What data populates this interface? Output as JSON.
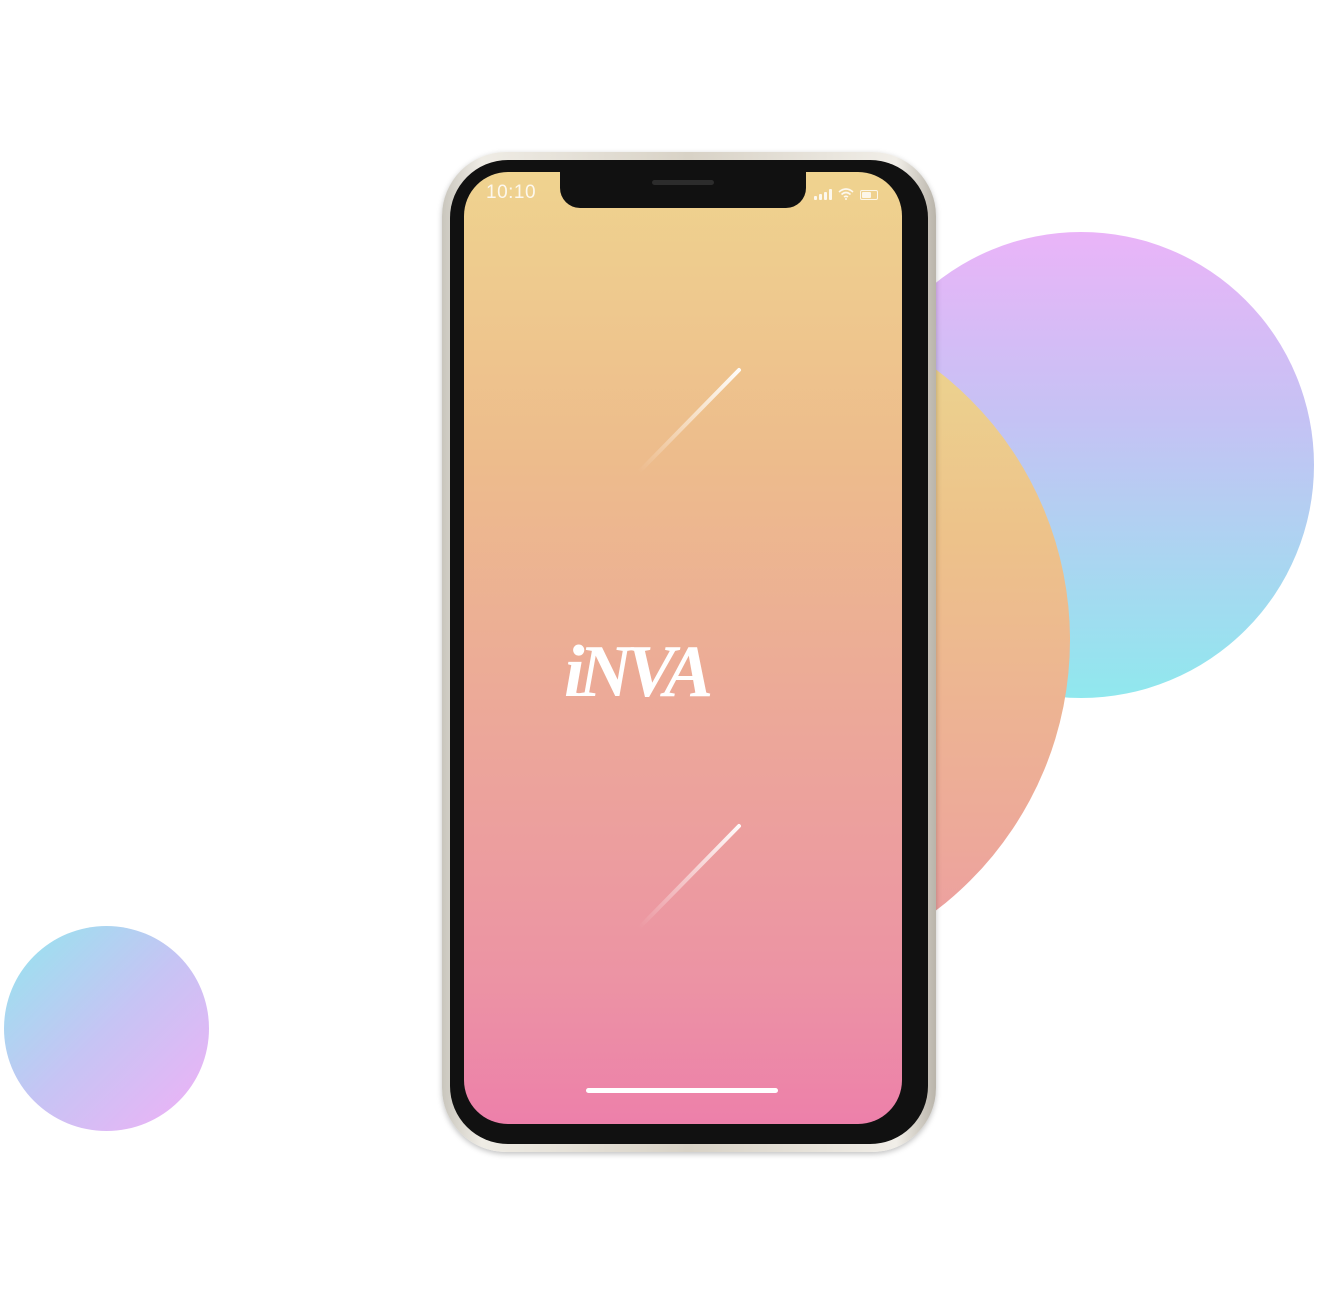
{
  "status_bar": {
    "time": "10:10",
    "icons": [
      "cellular-signal-icon",
      "wifi-icon",
      "battery-icon"
    ]
  },
  "splash": {
    "logo_text": "iNVA"
  },
  "colors": {
    "screen_gradient_top": "#efd38f",
    "screen_gradient_bottom": "#ed80aa",
    "blue_circle_top": "#eab4f8",
    "blue_circle_bottom": "#90e8ee",
    "orange_circle_top": "#ecd890",
    "orange_circle_bottom": "#ec9aa4",
    "small_circle_start": "#93e6ee",
    "small_circle_end": "#f1b0f6"
  }
}
